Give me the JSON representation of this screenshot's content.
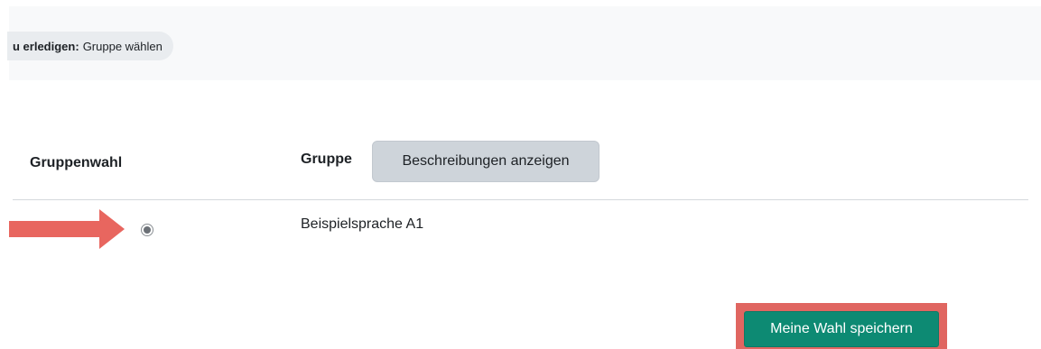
{
  "activity": {
    "todo_label": "u erledigen:",
    "todo_value": "Gruppe wählen"
  },
  "table": {
    "headers": {
      "choice": "Gruppenwahl",
      "group": "Gruppe"
    },
    "show_descriptions_label": "Beschreibungen anzeigen",
    "rows": [
      {
        "group": "Beispielsprache A1",
        "selected": true
      }
    ]
  },
  "actions": {
    "save_label": "Meine Wahl speichern"
  },
  "colors": {
    "primary": "#0d8a73",
    "highlight": "#e06661",
    "secondary_button": "#ced4da"
  },
  "icons": {
    "annotation": "right-arrow-icon",
    "selection": "radio-selected-icon"
  }
}
